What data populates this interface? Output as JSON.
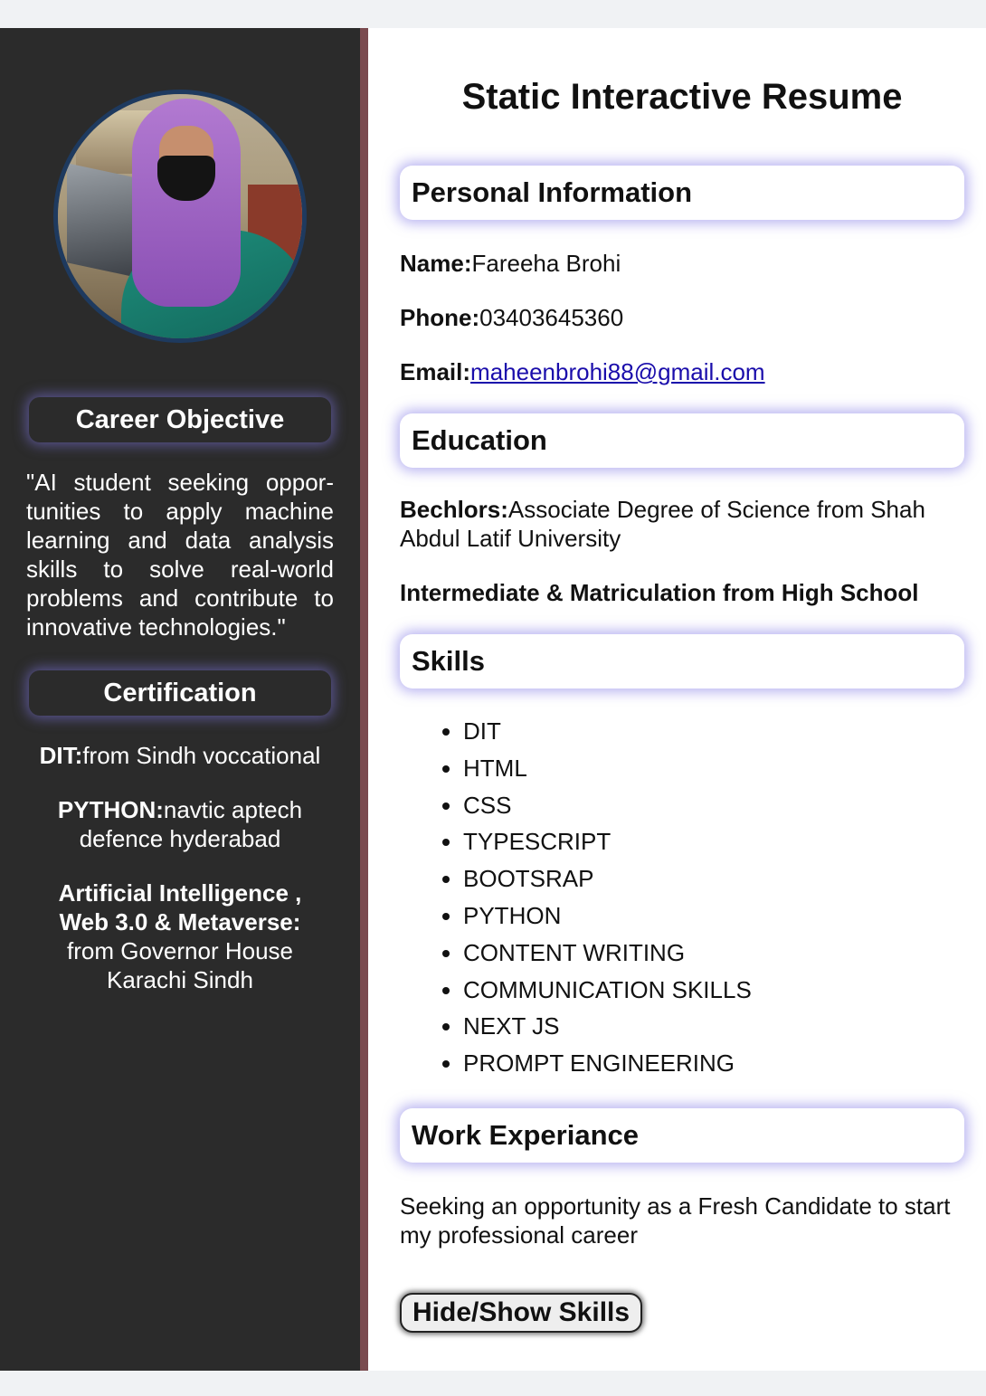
{
  "sidebar": {
    "career_heading": "Career Objective",
    "career_objective": "\"AI student seeking oppor-tunities to apply machine learning and data analysis skills to solve real-world problems and contribute to innovative technologies.\"",
    "cert_heading": "Certification",
    "certifications": [
      {
        "label": "DIT:",
        "text": "from Sindh voccational"
      },
      {
        "label": "PYTHON:",
        "text": "navtic aptech defence hyderabad"
      },
      {
        "label": "Artificial Intelligence , Web 3.0 & Metaverse:",
        "text": "from Governor House Karachi Sindh"
      }
    ]
  },
  "main": {
    "title": "Static Interactive Resume",
    "personal": {
      "heading": "Personal Information",
      "name_label": "Name:",
      "name": "Fareeha Brohi",
      "phone_label": "Phone:",
      "phone": "03403645360",
      "email_label": "Email:",
      "email": "maheenbrohi88@gmail.com"
    },
    "education": {
      "heading": "Education",
      "bachelors_label": "Bechlors:",
      "bachelors": "Associate Degree of Science from Shah Abdul Latif University",
      "intermediate": "Intermediate & Matriculation from High School"
    },
    "skills": {
      "heading": "Skills",
      "items": [
        "DIT",
        "HTML",
        "CSS",
        "TYPESCRIPT",
        "BOOTSRAP",
        "PYTHON",
        "CONTENT WRITING",
        "COMMUNICATION SKILLS",
        "NEXT JS",
        "PROMPT ENGINEERING"
      ]
    },
    "work": {
      "heading": "Work Experiance",
      "text": "Seeking an opportunity as a Fresh Candidate to start my professional career"
    },
    "toggle_button": "Hide/Show Skills"
  },
  "colors": {
    "sidebar_bg": "#2b2b2b",
    "divider": "#7a4b4f",
    "glow": "#8278e6",
    "link": "#1a0dab"
  }
}
